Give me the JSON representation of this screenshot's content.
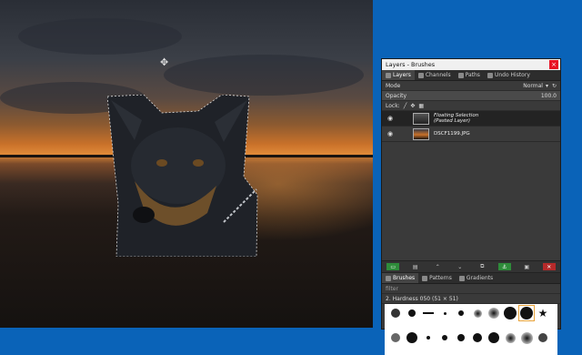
{
  "dock": {
    "title": "Layers - Brushes",
    "close_glyph": "×",
    "tabs": [
      {
        "label": "Layers",
        "active": true
      },
      {
        "label": "Channels",
        "active": false
      },
      {
        "label": "Paths",
        "active": false
      },
      {
        "label": "Undo History",
        "active": false
      }
    ],
    "mode_label": "Mode",
    "mode_value": "Normal",
    "opacity_label": "Opacity",
    "opacity_value": "100.0",
    "lock_label": "Lock:",
    "layers": [
      {
        "name": "Floating Selection",
        "sub": "(Pasted Layer)",
        "selected": true
      },
      {
        "name": "DSCF1199.JPG",
        "sub": "",
        "selected": false
      }
    ],
    "bottom_tabs": [
      {
        "label": "Brushes",
        "active": true
      },
      {
        "label": "Patterns",
        "active": false
      },
      {
        "label": "Gradients",
        "active": false
      }
    ],
    "filter_label": "filter",
    "brush_name": "2. Hardness 050 (51 × 51)"
  },
  "colors": {
    "desktop": "#0a63b8",
    "accent_green": "#2e8b3a",
    "accent_red": "#b52a2a"
  }
}
